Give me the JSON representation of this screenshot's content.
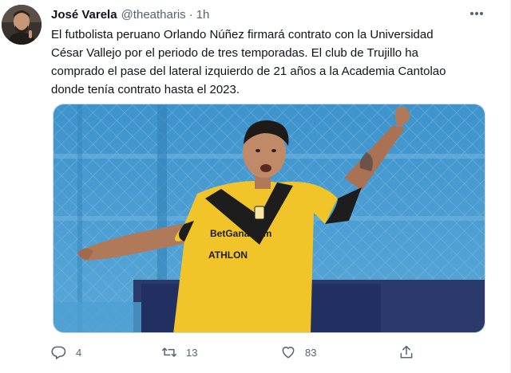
{
  "tweet": {
    "author": {
      "name": "José Varela",
      "handle": "@theatharis",
      "separator": "·",
      "time": "1h"
    },
    "text_lines": [
      "El futbolista peruano Orlando Núñez firmará contrato con la Universidad",
      "César Vallejo por el periodo de tres temporadas. El club de Trujillo ha",
      "comprado el pase del lateral izquierdo de 21 años a la Academia Cantolao",
      "donde tenía contrato hasta el 2023."
    ],
    "media": {
      "jersey_text_1": "BetGana.com",
      "jersey_text_2": "ATHLON",
      "jersey_color": "#f1c52a",
      "background_color": "#4f9fd1"
    },
    "actions": {
      "reply": {
        "icon": "reply-icon",
        "count": "4"
      },
      "retweet": {
        "icon": "retweet-icon",
        "count": "13"
      },
      "like": {
        "icon": "heart-icon",
        "count": "83"
      },
      "share": {
        "icon": "share-icon"
      }
    },
    "colors": {
      "text": "#0f1419",
      "secondary": "#536471",
      "border": "#cfd9de"
    }
  }
}
